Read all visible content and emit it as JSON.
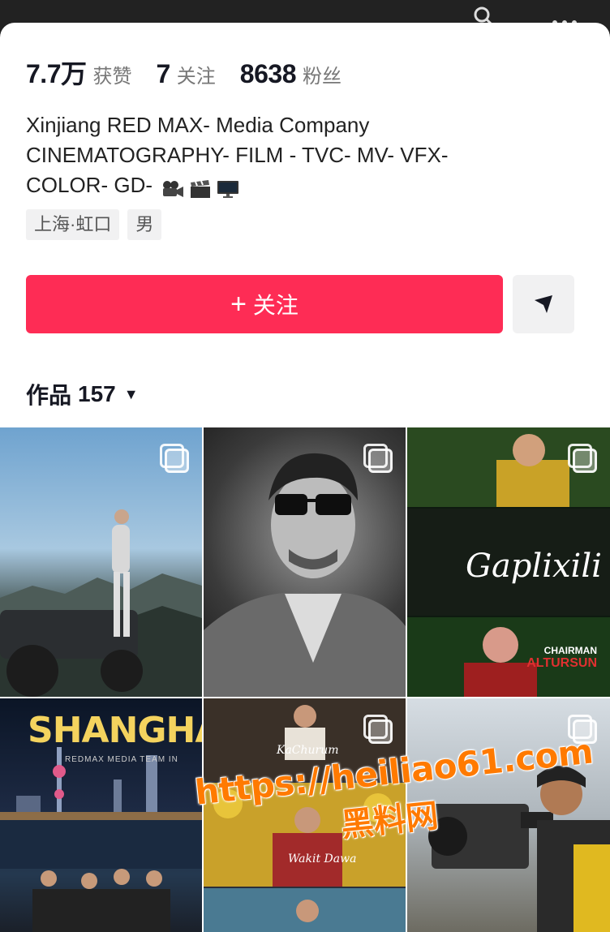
{
  "profile": {
    "stats": [
      {
        "value": "7.7万",
        "label": "获赞"
      },
      {
        "value": "7",
        "label": "关注"
      },
      {
        "value": "8638",
        "label": "粉丝"
      }
    ],
    "bio_lines": [
      "Xinjiang RED MAX- Media Company",
      "CINEMATOGRAPHY- FILM - TVC- MV- VFX-",
      "COLOR- GD-"
    ],
    "bio_emojis": [
      "video-camera-icon",
      "clapper-board-icon",
      "desktop-computer-icon"
    ],
    "tags": [
      "上海·虹口",
      "男"
    ],
    "follow_button": "关注",
    "follow_plus": "+"
  },
  "works": {
    "label": "作品",
    "count": "157"
  },
  "grid": {
    "tiles": [
      {
        "id": "tile-1",
        "multi": true
      },
      {
        "id": "tile-2",
        "multi": true
      },
      {
        "id": "tile-3",
        "multi": true,
        "text_main": "Gaplixili",
        "text_chairman": "CHAIRMAN",
        "text_name": "ALTURSUN"
      },
      {
        "id": "tile-4",
        "multi": false,
        "text_main": "SHANGHAI",
        "text_sub": "REDMAX MEDIA TEAM IN"
      },
      {
        "id": "tile-5",
        "multi": true,
        "text_a": "KaChurum",
        "text_b": "Wakit Dawa"
      },
      {
        "id": "tile-6",
        "multi": true
      }
    ]
  },
  "watermark": {
    "url": "https://heiliao61.com",
    "site": "黑料网"
  },
  "colors": {
    "primary": "#fe2c55",
    "text": "#161823",
    "muted": "#777777",
    "tag_bg": "#f1f1f2",
    "watermark": "#ff7a00"
  }
}
